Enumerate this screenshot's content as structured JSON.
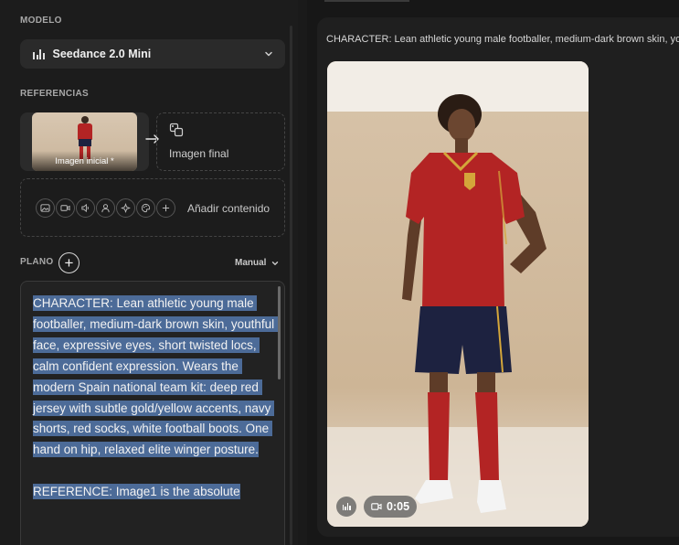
{
  "sidebar": {
    "model_label": "MODELO",
    "model_name": "Seedance 2.0 Mini",
    "references_label": "REFERENCIAS",
    "initial_image_label": "Imagen inicial *",
    "final_image_label": "Imagen final",
    "add_content_label": "Añadir contenido",
    "shot_label": "PLANO",
    "mode_label": "Manual",
    "prompt_text": "CHARACTER: Lean athletic young male footballer, medium-dark brown skin, youthful face, expressive eyes, short twisted locs, calm confident expression. Wears the modern Spain national team kit: deep red jersey with subtle gold/yellow accents, navy shorts, red socks, white football boots. One hand on hip, relaxed elite winger posture.\n\nREFERENCE: Image1 is the absolute"
  },
  "main": {
    "generation_prompt": "CHARACTER: Lean athletic young male footballer, medium-dark brown skin, youthful face, expressive eyes, short twisted locs, calm confident expression.",
    "duration": "0:05"
  },
  "icons": {
    "model": "model-bars-icon",
    "chevron": "chevron-down-icon",
    "arrow": "arrow-right-icon",
    "final_image": "image-icon",
    "tools": [
      "image-icon",
      "video-icon",
      "audio-icon",
      "character-icon",
      "effects-icon",
      "palette-icon",
      "plus-icon"
    ],
    "duration": "video-camera-icon"
  },
  "colors": {
    "background": "#1a1a1a",
    "selection_highlight": "#4c6b98",
    "jersey": "#b32424",
    "shorts": "#1d2240"
  }
}
